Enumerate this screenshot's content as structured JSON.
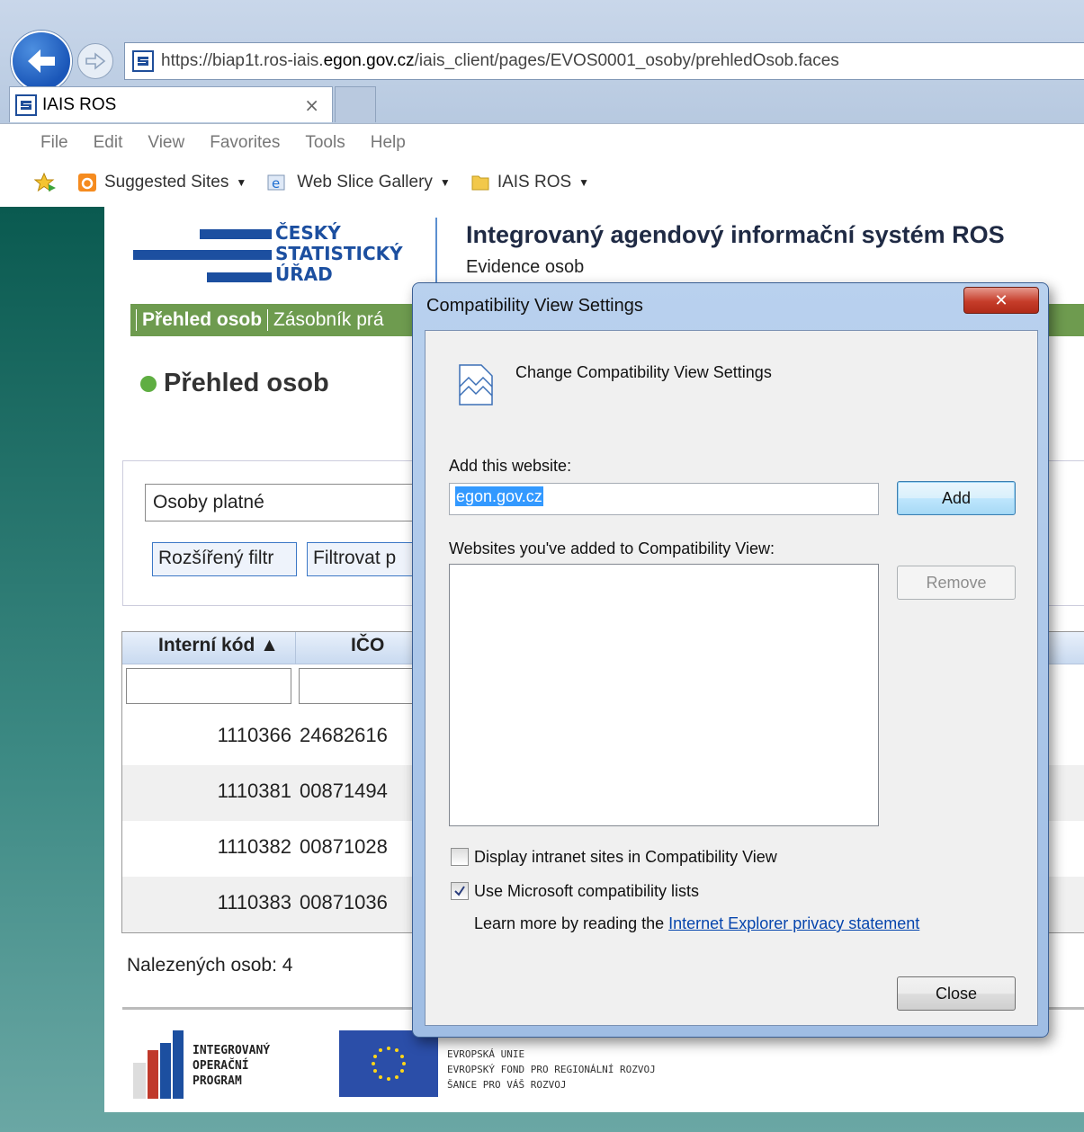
{
  "browser": {
    "url_prefix": "https://biap1t.ros-iais.",
    "url_domain": "egon.gov.cz",
    "url_path": "/iais_client/pages/EVOS0001_osoby/prehledOsob.faces",
    "tab_title": "IAIS ROS",
    "tab_close": "×",
    "menu": [
      "File",
      "Edit",
      "View",
      "Favorites",
      "Tools",
      "Help"
    ],
    "favorites": [
      {
        "label": "Suggested Sites",
        "icon": "suggested-sites-icon"
      },
      {
        "label": "Web Slice Gallery",
        "icon": "web-slice-icon"
      },
      {
        "label": "IAIS ROS",
        "icon": "folder-icon"
      }
    ]
  },
  "header": {
    "logo_lines": [
      "ČESKÝ",
      "STATISTICKÝ",
      "ÚŘAD"
    ],
    "system_title": "Integrovaný agendový informační systém ROS",
    "system_subtitle": "Evidence osob"
  },
  "nav": {
    "items": [
      "Přehled osob",
      "Zásobník prá"
    ]
  },
  "page": {
    "title": "Přehled osob",
    "filter_select": "Osoby platné",
    "btn_extended_filter": "Rozšířený filtr",
    "btn_filter_by": "Filtrovat p",
    "grid_headers": [
      "Interní kód ▲",
      "IČO"
    ],
    "rows": [
      {
        "code": "1110366",
        "ico": "24682616"
      },
      {
        "code": "1110381",
        "ico": "00871494"
      },
      {
        "code": "1110382",
        "ico": "00871028"
      },
      {
        "code": "1110383",
        "ico": "00871036"
      }
    ],
    "found_count": "Nalezených osob: 4"
  },
  "footer": {
    "iop_lines": [
      "INTEGROVANÝ",
      "OPERAČNÍ",
      "PROGRAM"
    ],
    "eu_lines": [
      "EVROPSKÁ UNIE",
      "EVROPSKÝ FOND PRO REGIONÁLNÍ ROZVOJ",
      "ŠANCE PRO VÁŠ ROZVOJ"
    ]
  },
  "dialog": {
    "title": "Compatibility View Settings",
    "close_glyph": "✕",
    "heading": "Change Compatibility View Settings",
    "add_label": "Add this website:",
    "add_value": "egon.gov.cz",
    "add_button": "Add",
    "list_label": "Websites you've added to Compatibility View:",
    "remove_button": "Remove",
    "chk_intranet": "Display intranet sites in Compatibility View",
    "chk_intranet_checked": false,
    "chk_mscompat": "Use Microsoft compatibility lists",
    "chk_mscompat_checked": true,
    "learn_more_prefix": "Learn more by reading the ",
    "learn_more_link": "Internet Explorer privacy statement",
    "close_button": "Close"
  },
  "colors": {
    "nav_green": "#6e9b4f",
    "logo_blue": "#1c4fa0",
    "teal_bg": "#0a5a50"
  }
}
